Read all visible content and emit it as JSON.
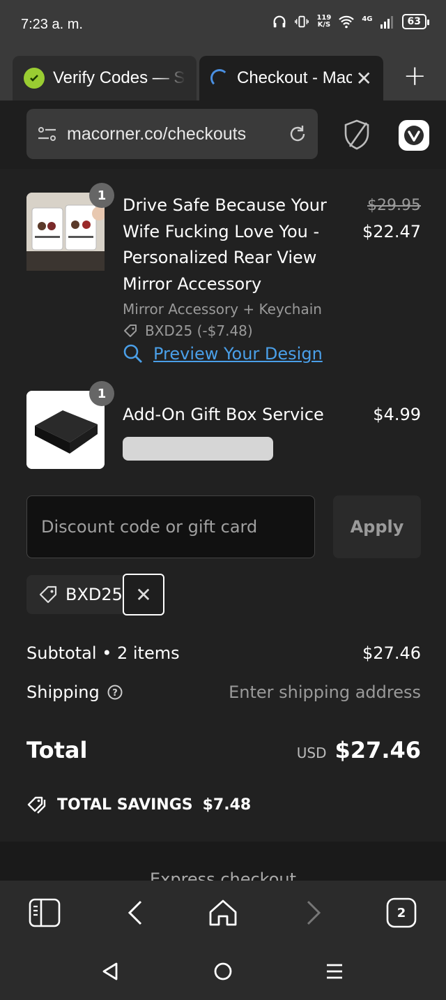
{
  "status_bar": {
    "time": "7:23 a. m.",
    "net_speed_value": "119",
    "net_speed_unit": "K/S",
    "network": "4G",
    "battery": "63"
  },
  "tabs": [
    {
      "title": "Verify Codes — S",
      "active": false
    },
    {
      "title": "Checkout - Mac",
      "active": true
    }
  ],
  "address_bar": {
    "url": "macorner.co/checkouts"
  },
  "products": [
    {
      "name": "Drive Safe Because Your Wife Fucking Love You - Personalized Rear View Mirror Accessory",
      "quantity": "1",
      "variant": "Mirror Accessory + Keychain",
      "discount": "BXD25 (-$7.48)",
      "preview_link": "Preview Your Design",
      "original_price": "$29.95",
      "price": "$22.47"
    },
    {
      "name": "Add-On Gift Box Service",
      "quantity": "1",
      "price": "$4.99"
    }
  ],
  "discount": {
    "placeholder": "Discount code or gift card",
    "apply_label": "Apply",
    "applied_code": "BXD25"
  },
  "summary": {
    "subtotal_label": "Subtotal • 2 items",
    "subtotal_value": "$27.46",
    "shipping_label": "Shipping",
    "shipping_value": "Enter shipping address",
    "total_label": "Total",
    "currency": "USD",
    "total_value": "$27.46",
    "savings_label": "TOTAL SAVINGS",
    "savings_value": "$7.48"
  },
  "express_checkout": "Express checkout",
  "bottom_nav": {
    "tab_count": "2"
  },
  "colors": {
    "background": "#212121",
    "link": "#4a9fe8",
    "muted": "#9a9a9a"
  }
}
